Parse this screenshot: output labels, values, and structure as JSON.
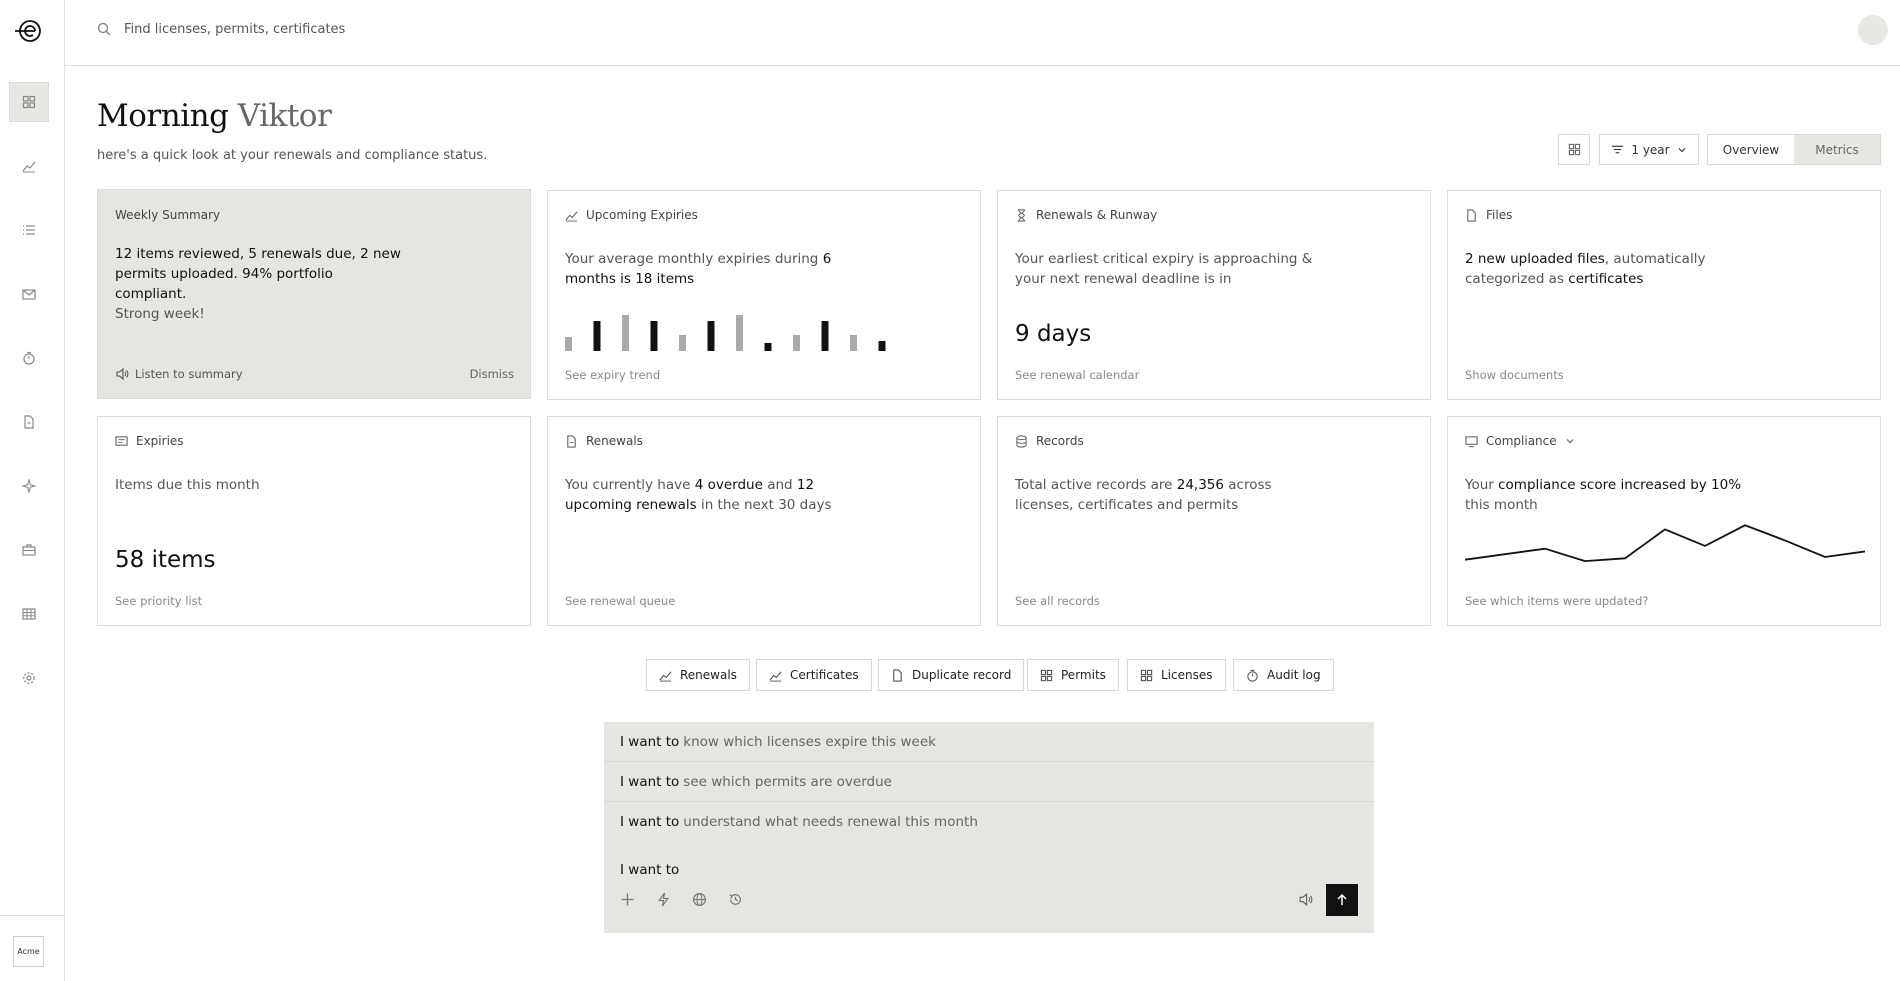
{
  "search": {
    "placeholder": "Find licenses, permits, certificates"
  },
  "sidebar": {
    "items": [
      {
        "icon": "grid-icon",
        "active": true
      },
      {
        "icon": "chart-icon"
      },
      {
        "icon": "list-icon"
      },
      {
        "icon": "mail-icon"
      },
      {
        "icon": "timer-icon"
      },
      {
        "icon": "document-icon"
      },
      {
        "icon": "sparkle-icon"
      },
      {
        "icon": "briefcase-icon"
      },
      {
        "icon": "table-icon"
      },
      {
        "icon": "gear-icon"
      }
    ],
    "workspace": "Acme"
  },
  "header": {
    "greeting": "Morning",
    "name": "Viktor",
    "subtitle": "here's a quick look at your renewals and compliance status."
  },
  "controls": {
    "range": "1 year",
    "tabs": [
      "Overview",
      "Metrics"
    ],
    "active_tab": "Metrics"
  },
  "cards": {
    "weekly": {
      "title": "Weekly Summary",
      "text_bold": "12 items reviewed, 5 renewals due, 2 new permits uploaded. 94% portfolio compliant.",
      "text_tail": "Strong week!",
      "listen": "Listen to summary",
      "dismiss": "Dismiss"
    },
    "expiries_upcoming": {
      "title": "Upcoming Expiries",
      "t1": "Your average monthly expiries during",
      "b1": "6 months is 18 items",
      "foot": "See expiry trend"
    },
    "runway": {
      "title": "Renewals & Runway",
      "text": "Your earliest critical expiry is approaching & your next renewal deadline is in",
      "big": "9 days",
      "foot": "See renewal calendar"
    },
    "files": {
      "title": "Files",
      "b1": "2 new uploaded files",
      "t1": ", automatically categorized as",
      "b2": "certificates",
      "foot": "Show documents"
    },
    "expiries": {
      "title": "Expiries",
      "text": "Items due this month",
      "big": "58 items",
      "foot": "See priority list"
    },
    "renewals": {
      "title": "Renewals",
      "t1": "You currently have",
      "b1": "4 overdue",
      "t2": "and",
      "b2": "12 upcoming renewals",
      "t3": "in the next 30 days",
      "foot": "See renewal queue"
    },
    "records": {
      "title": "Records",
      "t1": "Total active records are",
      "b1": "24,356",
      "t2": "across",
      "b2": "licenses, certificates and permits",
      "foot": "See all records"
    },
    "compliance": {
      "title": "Compliance",
      "t1": "Your",
      "b1": "compliance score increased by 10%",
      "t2": "this month",
      "foot": "See which items were updated?"
    }
  },
  "chart_data": [
    {
      "type": "bar",
      "values": [
        14,
        30,
        36,
        30,
        16,
        30,
        36,
        8,
        16,
        30,
        16,
        10
      ],
      "colors": [
        "#aaaaaa",
        "#111111",
        "#aaaaaa",
        "#111111",
        "#aaaaaa",
        "#111111",
        "#aaaaaa",
        "#111111",
        "#aaaaaa",
        "#111111",
        "#aaaaaa",
        "#111111"
      ]
    },
    {
      "type": "line",
      "values": [
        14,
        18,
        22,
        13,
        15,
        36,
        24,
        39,
        28,
        16,
        20
      ]
    }
  ],
  "chips": [
    "Renewals",
    "Certificates",
    "Duplicate record",
    "Permits",
    "Licenses",
    "Audit log"
  ],
  "prompt": {
    "prefix": "I want to",
    "suggestions": [
      "know which licenses expire this week",
      "see which permits are overdue",
      "understand what needs renewal this month"
    ]
  }
}
